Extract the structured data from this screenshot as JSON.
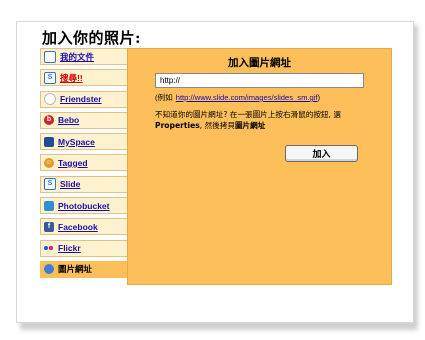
{
  "page": {
    "title": "加入你的照片:"
  },
  "sidebar": {
    "items": [
      {
        "label": "我的文件",
        "icon": "document-icon",
        "color": "#3b6fc4"
      },
      {
        "label": "搜尋!!",
        "icon": "s-icon",
        "color": "#2f6fd6"
      },
      {
        "label": "Friendster",
        "icon": "smiley-icon",
        "color": "#c8c8c8"
      },
      {
        "label": "Bebo",
        "icon": "bebo-icon",
        "color": "#d42020"
      },
      {
        "label": "MySpace",
        "icon": "myspace-icon",
        "color": "#1d4e9a"
      },
      {
        "label": "Tagged",
        "icon": "tagged-icon",
        "color": "#e39a2b"
      },
      {
        "label": "Slide",
        "icon": "slide-icon",
        "color": "#2f6fd6"
      },
      {
        "label": "Photobucket",
        "icon": "photobucket-icon",
        "color": "#2f8fd6"
      },
      {
        "label": "Facebook",
        "icon": "facebook-icon",
        "color": "#3b5998"
      },
      {
        "label": "Flickr",
        "icon": "flickr-icon",
        "color": "#ff0084"
      },
      {
        "label": "圖片網址",
        "icon": "globe-icon",
        "color": "#3b7fd6"
      }
    ]
  },
  "panel": {
    "title": "加入圖片網址",
    "url_value": "http://",
    "example_prefix": "(例如",
    "example_link": "http://www.slide.com/images/slides_sm.gif",
    "example_suffix": ")",
    "help_line1": "不知道你的圖片網址? 在一張圖片上按右滑鼠的按鈕, 選",
    "help_line2_bold1": "Properties",
    "help_line2_mid": ", 然後拷貝",
    "help_line2_bold2": "圖片網址",
    "add_label": "加入"
  }
}
